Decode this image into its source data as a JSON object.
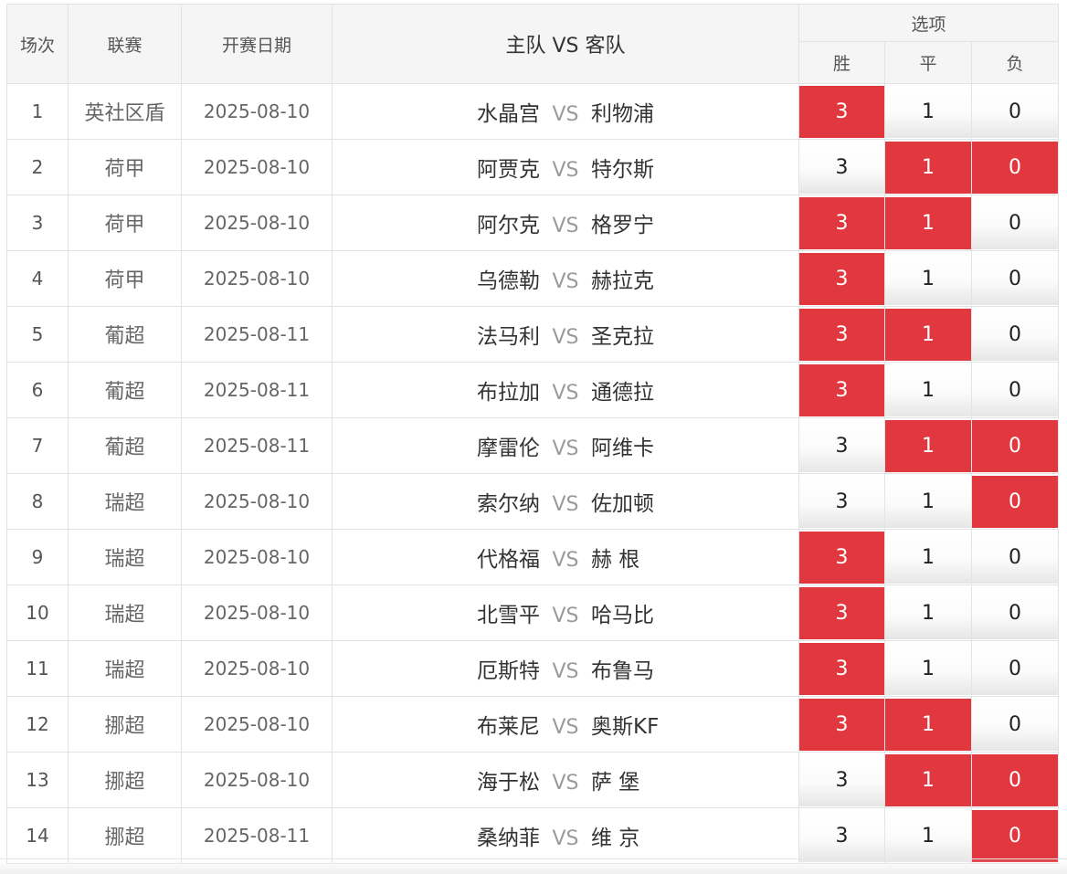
{
  "header": {
    "col_num": "场次",
    "col_league": "联赛",
    "col_date": "开赛日期",
    "col_teams": "主队 VS 客队",
    "col_options": "选项",
    "opt_win": "胜",
    "opt_draw": "平",
    "opt_lose": "负"
  },
  "vs_label": "VS",
  "colors": {
    "selected": "#e0383e",
    "unselected": "#f5f5f5"
  },
  "rows": [
    {
      "num": "1",
      "league": "英社区盾",
      "date": "2025-08-10",
      "home": "水晶宫",
      "away": "利物浦",
      "win": "3",
      "draw": "1",
      "lose": "0",
      "sel_win": true,
      "sel_draw": false,
      "sel_lose": false
    },
    {
      "num": "2",
      "league": "荷甲",
      "date": "2025-08-10",
      "home": "阿贾克",
      "away": "特尔斯",
      "win": "3",
      "draw": "1",
      "lose": "0",
      "sel_win": false,
      "sel_draw": true,
      "sel_lose": true
    },
    {
      "num": "3",
      "league": "荷甲",
      "date": "2025-08-10",
      "home": "阿尔克",
      "away": "格罗宁",
      "win": "3",
      "draw": "1",
      "lose": "0",
      "sel_win": true,
      "sel_draw": true,
      "sel_lose": false
    },
    {
      "num": "4",
      "league": "荷甲",
      "date": "2025-08-10",
      "home": "乌德勒",
      "away": "赫拉克",
      "win": "3",
      "draw": "1",
      "lose": "0",
      "sel_win": true,
      "sel_draw": false,
      "sel_lose": false
    },
    {
      "num": "5",
      "league": "葡超",
      "date": "2025-08-11",
      "home": "法马利",
      "away": "圣克拉",
      "win": "3",
      "draw": "1",
      "lose": "0",
      "sel_win": true,
      "sel_draw": true,
      "sel_lose": false
    },
    {
      "num": "6",
      "league": "葡超",
      "date": "2025-08-11",
      "home": "布拉加",
      "away": "通德拉",
      "win": "3",
      "draw": "1",
      "lose": "0",
      "sel_win": true,
      "sel_draw": false,
      "sel_lose": false
    },
    {
      "num": "7",
      "league": "葡超",
      "date": "2025-08-11",
      "home": "摩雷伦",
      "away": "阿维卡",
      "win": "3",
      "draw": "1",
      "lose": "0",
      "sel_win": false,
      "sel_draw": true,
      "sel_lose": true
    },
    {
      "num": "8",
      "league": "瑞超",
      "date": "2025-08-10",
      "home": "索尔纳",
      "away": "佐加顿",
      "win": "3",
      "draw": "1",
      "lose": "0",
      "sel_win": false,
      "sel_draw": false,
      "sel_lose": true
    },
    {
      "num": "9",
      "league": "瑞超",
      "date": "2025-08-10",
      "home": "代格福",
      "away": "赫 根",
      "win": "3",
      "draw": "1",
      "lose": "0",
      "sel_win": true,
      "sel_draw": false,
      "sel_lose": false
    },
    {
      "num": "10",
      "league": "瑞超",
      "date": "2025-08-10",
      "home": "北雪平",
      "away": "哈马比",
      "win": "3",
      "draw": "1",
      "lose": "0",
      "sel_win": true,
      "sel_draw": false,
      "sel_lose": false
    },
    {
      "num": "11",
      "league": "瑞超",
      "date": "2025-08-10",
      "home": "厄斯特",
      "away": "布鲁马",
      "win": "3",
      "draw": "1",
      "lose": "0",
      "sel_win": true,
      "sel_draw": false,
      "sel_lose": false
    },
    {
      "num": "12",
      "league": "挪超",
      "date": "2025-08-10",
      "home": "布莱尼",
      "away": "奥斯KF",
      "win": "3",
      "draw": "1",
      "lose": "0",
      "sel_win": true,
      "sel_draw": true,
      "sel_lose": false
    },
    {
      "num": "13",
      "league": "挪超",
      "date": "2025-08-10",
      "home": "海于松",
      "away": "萨 堡",
      "win": "3",
      "draw": "1",
      "lose": "0",
      "sel_win": false,
      "sel_draw": true,
      "sel_lose": true
    },
    {
      "num": "14",
      "league": "挪超",
      "date": "2025-08-11",
      "home": "桑纳菲",
      "away": "维 京",
      "win": "3",
      "draw": "1",
      "lose": "0",
      "sel_win": false,
      "sel_draw": false,
      "sel_lose": true
    }
  ]
}
